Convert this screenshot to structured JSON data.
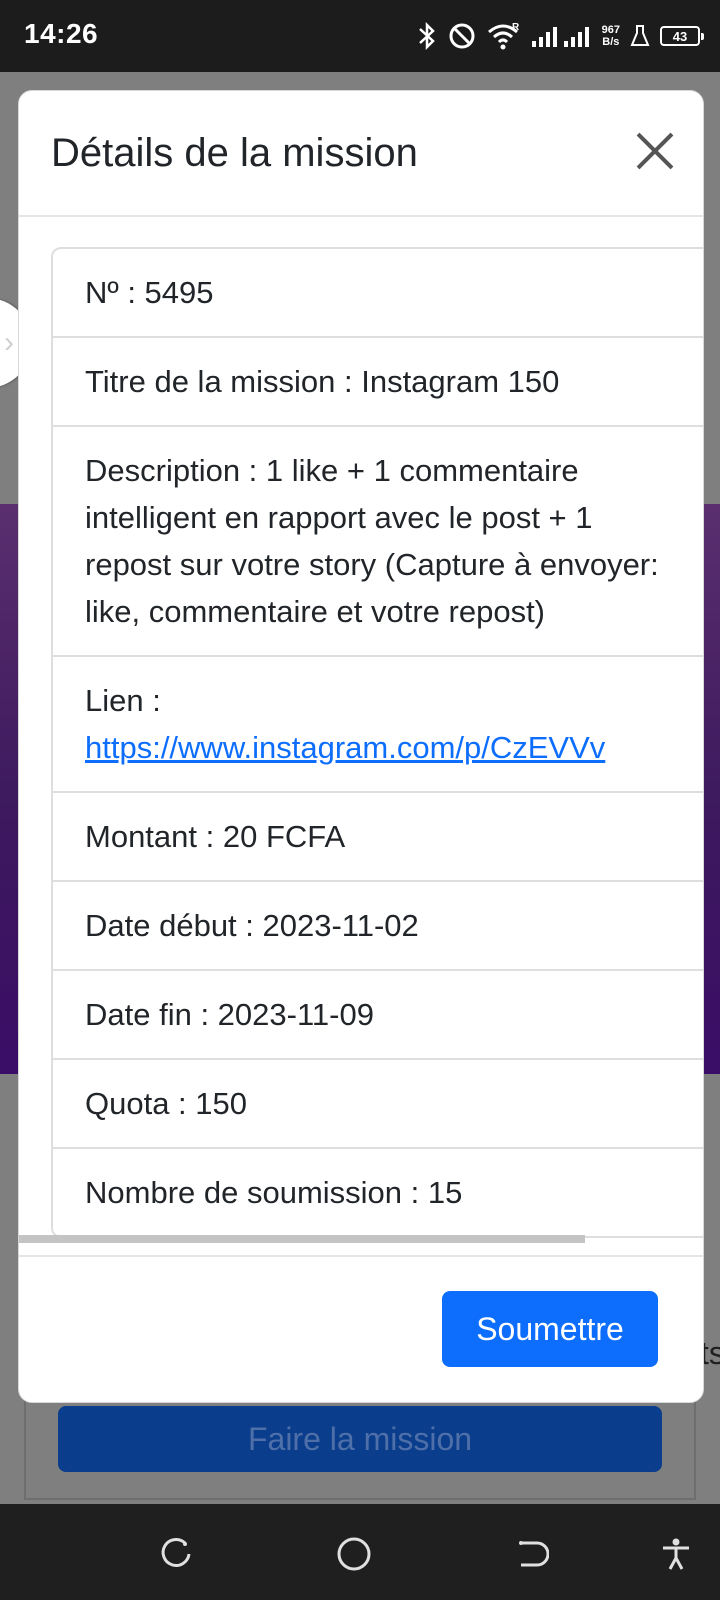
{
  "status_bar": {
    "time": "14:26",
    "net_speed_value": "967",
    "net_speed_unit": "B/s",
    "battery": "43",
    "signal_badge": "R"
  },
  "background": {
    "button_label": "Faire la mission",
    "side_text": "ts"
  },
  "modal": {
    "title": "Détails de la mission",
    "details": [
      "Nº : 5495",
      "Titre de la mission : Instagram 150",
      "Description : 1 like + 1 commentaire intelligent en rapport avec le post + 1 repost sur votre story (Capture à envoyer: like, commentaire et votre repost)",
      "Montant : 20 FCFA",
      "Date début : 2023-11-02",
      "Date fin : 2023-11-09",
      "Quota : 150",
      "Nombre de soumission : 15"
    ],
    "link_label": "Lien :",
    "link_url": "https://www.instagram.com/p/CzEVVv",
    "submit_label": "Soumettre"
  },
  "colors": {
    "primary": "#0d6efd",
    "background_accent": "#3e1a5e",
    "status_bar": "#1c1c1c"
  },
  "icons": [
    "bluetooth-icon",
    "do-not-disturb-icon",
    "wifi-icon",
    "signal-icon",
    "flask-icon",
    "battery-icon",
    "close-icon",
    "chevron-right-icon",
    "recents-icon",
    "home-icon",
    "back-icon",
    "accessibility-icon"
  ]
}
